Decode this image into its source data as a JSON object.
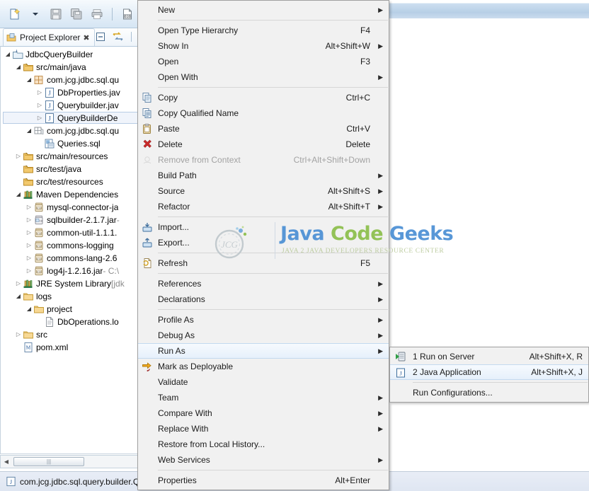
{
  "toolbar": {
    "buttons": [
      {
        "name": "new-wizard",
        "icon": "new-file-icon"
      },
      {
        "name": "new-dropdown",
        "icon": "chevron-down-icon"
      },
      {
        "name": "save",
        "icon": "save-icon"
      },
      {
        "name": "save-all",
        "icon": "save-all-icon"
      },
      {
        "name": "print",
        "icon": "print-icon"
      },
      {
        "name": "toggle-breakpoint",
        "icon": "binary-icon"
      },
      {
        "name": "skip-breakpoints",
        "icon": "skip-breakpoints-icon"
      }
    ]
  },
  "project_explorer": {
    "tab_label": "Project Explorer",
    "tab_close_glyph": "✖",
    "view_buttons": [
      {
        "name": "collapse-all",
        "icon": "collapse-all-icon"
      },
      {
        "name": "link-with-editor",
        "icon": "link-editor-icon"
      }
    ],
    "tree": [
      {
        "indent": 0,
        "arrow": "open",
        "icon": "java-project-icon",
        "label": "JdbcQueryBuilder",
        "selected": false
      },
      {
        "indent": 1,
        "arrow": "open",
        "icon": "source-folder-icon",
        "label": "src/main/java",
        "selected": false
      },
      {
        "indent": 2,
        "arrow": "open",
        "icon": "package-icon",
        "label": "com.jcg.jdbc.sql.qu",
        "selected": false
      },
      {
        "indent": 3,
        "arrow": "closed",
        "icon": "java-file-icon",
        "label": "DbProperties.jav",
        "selected": false
      },
      {
        "indent": 3,
        "arrow": "closed",
        "icon": "java-file-icon",
        "label": "Querybuilder.jav",
        "selected": false
      },
      {
        "indent": 3,
        "arrow": "closed",
        "icon": "java-file-icon",
        "label": "QueryBuilderDe",
        "selected": true
      },
      {
        "indent": 2,
        "arrow": "open",
        "icon": "package-empty-icon",
        "label": "com.jcg.jdbc.sql.qu",
        "selected": false
      },
      {
        "indent": 3,
        "arrow": "none",
        "icon": "sql-file-icon",
        "label": "Queries.sql",
        "selected": false
      },
      {
        "indent": 1,
        "arrow": "closed",
        "icon": "source-folder-icon",
        "label": "src/main/resources",
        "selected": false
      },
      {
        "indent": 1,
        "arrow": "none",
        "icon": "source-folder-icon",
        "label": "src/test/java",
        "selected": false
      },
      {
        "indent": 1,
        "arrow": "none",
        "icon": "source-folder-icon",
        "label": "src/test/resources",
        "selected": false
      },
      {
        "indent": 1,
        "arrow": "open",
        "icon": "library-icon",
        "label": "Maven Dependencies",
        "selected": false
      },
      {
        "indent": 2,
        "arrow": "closed",
        "icon": "jar-icon",
        "label": "mysql-connector-ja",
        "selected": false
      },
      {
        "indent": 2,
        "arrow": "closed",
        "icon": "jar-src-icon",
        "label": "sqlbuilder-2.1.7.jar ",
        "suffix": "-",
        "selected": false
      },
      {
        "indent": 2,
        "arrow": "closed",
        "icon": "jar-icon",
        "label": "common-util-1.1.1.",
        "selected": false
      },
      {
        "indent": 2,
        "arrow": "closed",
        "icon": "jar-icon",
        "label": "commons-logging",
        "selected": false
      },
      {
        "indent": 2,
        "arrow": "closed",
        "icon": "jar-icon",
        "label": "commons-lang-2.6",
        "selected": false
      },
      {
        "indent": 2,
        "arrow": "closed",
        "icon": "jar-icon",
        "label": "log4j-1.2.16.jar ",
        "suffix": "- C:\\",
        "selected": false
      },
      {
        "indent": 1,
        "arrow": "closed",
        "icon": "library-icon",
        "label": "JRE System Library ",
        "suffix": "[jdk",
        "selected": false
      },
      {
        "indent": 1,
        "arrow": "open",
        "icon": "folder-icon",
        "label": "logs",
        "selected": false
      },
      {
        "indent": 2,
        "arrow": "open",
        "icon": "folder-icon",
        "label": "project",
        "selected": false
      },
      {
        "indent": 3,
        "arrow": "none",
        "icon": "text-file-icon",
        "label": "DbOperations.lo",
        "selected": false
      },
      {
        "indent": 1,
        "arrow": "closed",
        "icon": "folder-icon",
        "label": "src",
        "selected": false
      },
      {
        "indent": 1,
        "arrow": "none",
        "icon": "xml-file-icon",
        "label": "pom.xml",
        "selected": false
      }
    ],
    "hscroll": {
      "left_arrow": "◀",
      "thumb_grip": "|||"
    }
  },
  "context_menu": {
    "items": [
      {
        "label": "New",
        "accel": "",
        "submenu": true,
        "icon": "",
        "disabled": false,
        "highlight": false
      },
      {
        "separator": true,
        "full": true
      },
      {
        "label": "Open Type Hierarchy",
        "accel": "F4",
        "submenu": false,
        "icon": "",
        "disabled": false,
        "highlight": false
      },
      {
        "label": "Show In",
        "accel": "Alt+Shift+W",
        "submenu": true,
        "icon": "",
        "disabled": false,
        "highlight": false
      },
      {
        "label": "Open",
        "accel": "F3",
        "submenu": false,
        "icon": "",
        "disabled": false,
        "highlight": false
      },
      {
        "label": "Open With",
        "accel": "",
        "submenu": true,
        "icon": "",
        "disabled": false,
        "highlight": false
      },
      {
        "separator": true,
        "full": true
      },
      {
        "label": "Copy",
        "accel": "Ctrl+C",
        "submenu": false,
        "icon": "copy-icon",
        "disabled": false,
        "highlight": false
      },
      {
        "label": "Copy Qualified Name",
        "accel": "",
        "submenu": false,
        "icon": "copy-qualified-icon",
        "disabled": false,
        "highlight": false
      },
      {
        "label": "Paste",
        "accel": "Ctrl+V",
        "submenu": false,
        "icon": "paste-icon",
        "disabled": false,
        "highlight": false
      },
      {
        "label": "Delete",
        "accel": "Delete",
        "submenu": false,
        "icon": "delete-icon",
        "disabled": false,
        "highlight": false
      },
      {
        "label": "Remove from Context",
        "accel": "Ctrl+Alt+Shift+Down",
        "submenu": false,
        "icon": "remove-context-icon",
        "disabled": true,
        "highlight": false
      },
      {
        "label": "Build Path",
        "accel": "",
        "submenu": true,
        "icon": "",
        "disabled": false,
        "highlight": false
      },
      {
        "label": "Source",
        "accel": "Alt+Shift+S",
        "submenu": true,
        "icon": "",
        "disabled": false,
        "highlight": false
      },
      {
        "label": "Refactor",
        "accel": "Alt+Shift+T",
        "submenu": true,
        "icon": "",
        "disabled": false,
        "highlight": false
      },
      {
        "separator": true,
        "full": true
      },
      {
        "label": "Import...",
        "accel": "",
        "submenu": false,
        "icon": "import-icon",
        "disabled": false,
        "highlight": false
      },
      {
        "label": "Export...",
        "accel": "",
        "submenu": false,
        "icon": "export-icon",
        "disabled": false,
        "highlight": false
      },
      {
        "separator": true,
        "full": false
      },
      {
        "label": "Refresh",
        "accel": "F5",
        "submenu": false,
        "icon": "refresh-icon",
        "disabled": false,
        "highlight": false
      },
      {
        "separator": true,
        "full": true
      },
      {
        "label": "References",
        "accel": "",
        "submenu": true,
        "icon": "",
        "disabled": false,
        "highlight": false
      },
      {
        "label": "Declarations",
        "accel": "",
        "submenu": true,
        "icon": "",
        "disabled": false,
        "highlight": false
      },
      {
        "separator": true,
        "full": true
      },
      {
        "label": "Profile As",
        "accel": "",
        "submenu": true,
        "icon": "",
        "disabled": false,
        "highlight": false
      },
      {
        "label": "Debug As",
        "accel": "",
        "submenu": true,
        "icon": "",
        "disabled": false,
        "highlight": false
      },
      {
        "label": "Run As",
        "accel": "",
        "submenu": true,
        "icon": "",
        "disabled": false,
        "highlight": true
      },
      {
        "label": "Mark as Deployable",
        "accel": "",
        "submenu": false,
        "icon": "deploy-icon",
        "disabled": false,
        "highlight": false
      },
      {
        "label": "Validate",
        "accel": "",
        "submenu": false,
        "icon": "",
        "disabled": false,
        "highlight": false
      },
      {
        "label": "Team",
        "accel": "",
        "submenu": true,
        "icon": "",
        "disabled": false,
        "highlight": false
      },
      {
        "label": "Compare With",
        "accel": "",
        "submenu": true,
        "icon": "",
        "disabled": false,
        "highlight": false
      },
      {
        "label": "Replace With",
        "accel": "",
        "submenu": true,
        "icon": "",
        "disabled": false,
        "highlight": false
      },
      {
        "label": "Restore from Local History...",
        "accel": "",
        "submenu": false,
        "icon": "",
        "disabled": false,
        "highlight": false
      },
      {
        "label": "Web Services",
        "accel": "",
        "submenu": true,
        "icon": "",
        "disabled": false,
        "highlight": false
      },
      {
        "separator": true,
        "full": true
      },
      {
        "label": "Properties",
        "accel": "Alt+Enter",
        "submenu": false,
        "icon": "",
        "disabled": false,
        "highlight": false
      }
    ],
    "submenu_arrow_glyph": "▶"
  },
  "run_as_submenu": {
    "items": [
      {
        "label": "1 Run on Server",
        "accel": "Alt+Shift+X, R",
        "icon": "run-on-server-icon",
        "highlight": false
      },
      {
        "label": "2 Java Application",
        "accel": "Alt+Shift+X, J",
        "icon": "java-app-icon",
        "highlight": true
      },
      {
        "separator": true
      },
      {
        "label": "Run Configurations...",
        "accel": "",
        "icon": "",
        "highlight": false
      }
    ]
  },
  "status_bar": {
    "icon": "java-file-icon",
    "label": "com.jcg.jdbc.sql.query.builder.Q"
  },
  "watermark": {
    "ring_text": "JCG",
    "title_java": "Java",
    "title_code": "Code",
    "title_geeks": "Geeks",
    "subtitle": "JAVA 2 JAVA DEVELOPERS RESOURCE CENTER"
  },
  "colors": {
    "menu_bg": "#f1f1f1",
    "menu_border": "#a0a0a0",
    "highlight_border": "#c3d9ef",
    "selection_bg": "#f0f4fb",
    "toolbar_grad_top": "#f6fafd",
    "toolbar_grad_bottom": "#d6e6f4",
    "editor_tab_blue": "#b7cfe6",
    "status_bg": "#e4eaf4",
    "accent_blue": "#4a8fd4",
    "accent_green": "#8cbf4a"
  }
}
